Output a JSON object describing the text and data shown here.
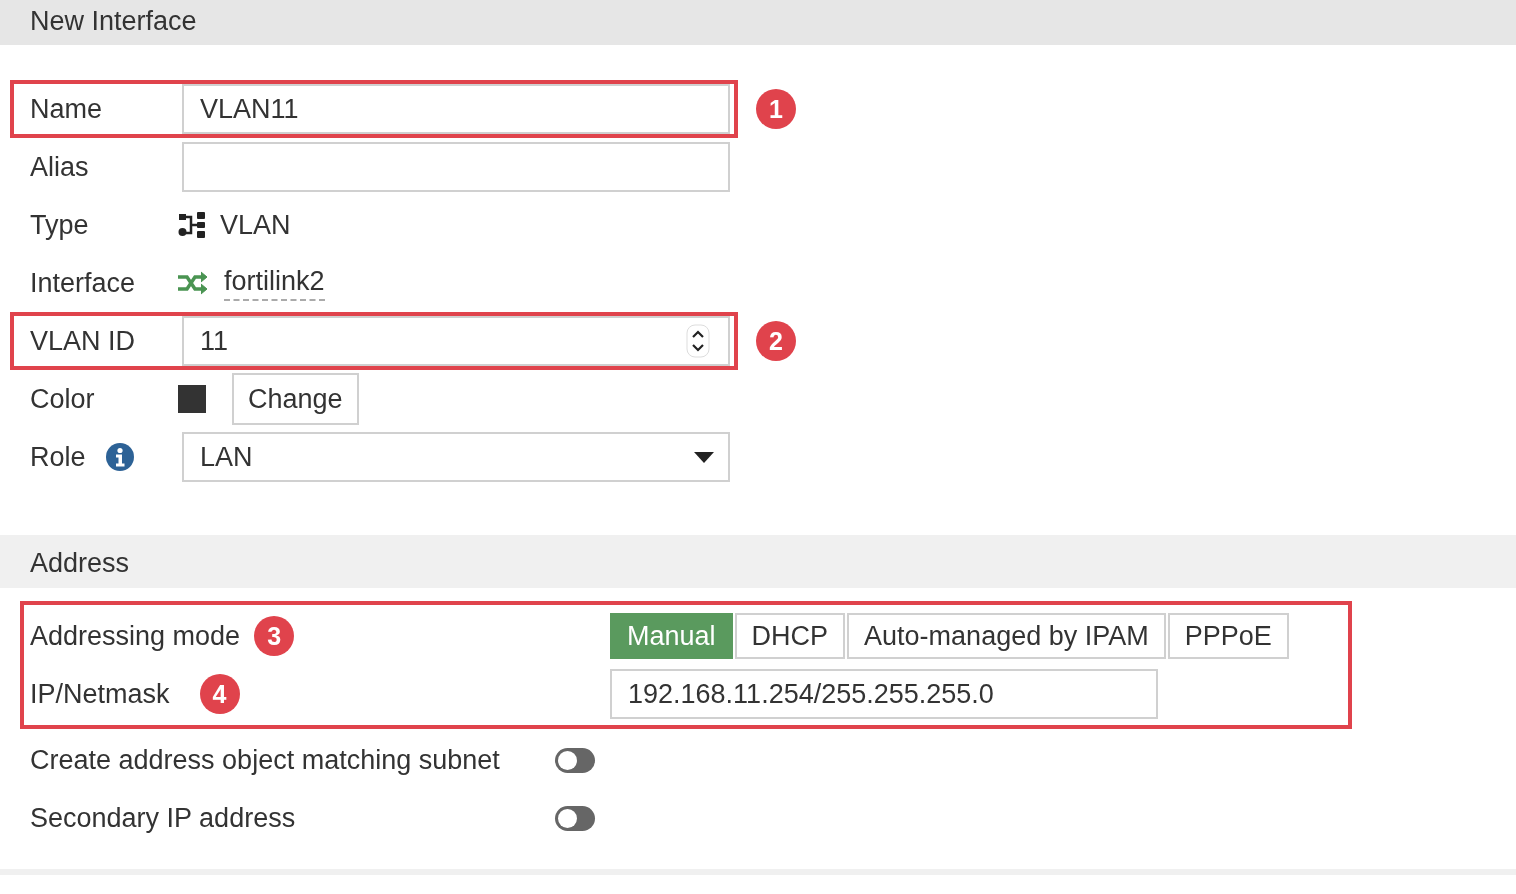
{
  "header": {
    "title": "New Interface"
  },
  "fields": [
    {
      "kind": "text",
      "label": "Name",
      "value": "VLAN11",
      "highlight": "1"
    },
    {
      "kind": "text",
      "label": "Alias"
    },
    {
      "kind": "static",
      "label": "Type",
      "value": "VLAN"
    },
    {
      "kind": "link",
      "label": "Interface",
      "value": "fortilink2"
    },
    {
      "kind": "number",
      "label": "VLAN ID",
      "value": "11",
      "highlight": "2"
    },
    {
      "kind": "color",
      "label": "Color",
      "color": "#333333",
      "button": "Change"
    },
    {
      "kind": "select",
      "label": "Role",
      "value": "LAN",
      "info": true
    }
  ],
  "address": {
    "title": "Address",
    "mode": {
      "label": "Addressing mode",
      "badge": "3",
      "options": [
        {
          "label": "Manual",
          "selected": true
        },
        {
          "label": "DHCP",
          "selected": false
        },
        {
          "label": "Auto-managed by IPAM",
          "selected": false
        },
        {
          "label": "PPPoE",
          "selected": false
        }
      ]
    },
    "ip": {
      "label": "IP/Netmask",
      "badge": "4",
      "value": "192.168.11.254/255.255.255.0"
    },
    "toggles": [
      {
        "label": "Create address object matching subnet",
        "on": false
      },
      {
        "label": "Secondary IP address",
        "on": false
      }
    ]
  }
}
